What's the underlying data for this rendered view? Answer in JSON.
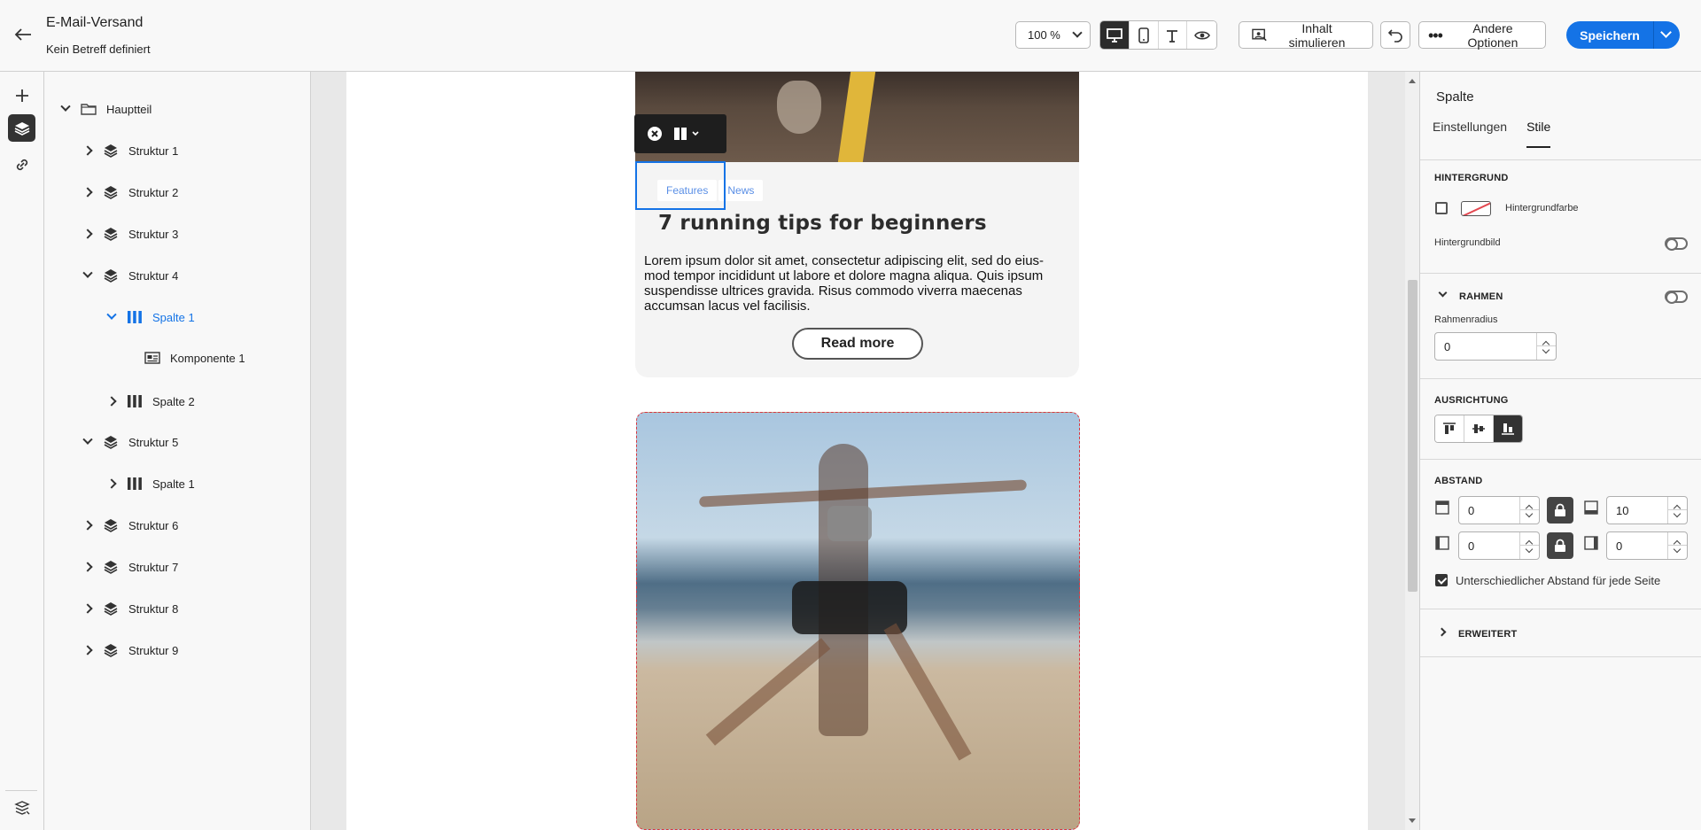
{
  "header": {
    "title": "E-Mail-Versand",
    "subtitle": "Kein Betreff definiert",
    "zoom": "100 %",
    "simulate_label": "Inhalt simulieren",
    "other_options_label": "Andere Optionen",
    "save_label": "Speichern"
  },
  "tree": {
    "root": "Hauptteil",
    "nodes": {
      "s1": "Struktur 1",
      "s2": "Struktur 2",
      "s3": "Struktur 3",
      "s4": "Struktur 4",
      "s4c1": "Spalte 1",
      "s4c1k": "Komponente 1",
      "s4c2": "Spalte 2",
      "s5": "Struktur 5",
      "s5c1": "Spalte 1",
      "s6": "Struktur 6",
      "s7": "Struktur 7",
      "s8": "Struktur 8",
      "s9": "Struktur 9"
    }
  },
  "canvas": {
    "tags": [
      "Features",
      "News"
    ],
    "card_title": "7 running tips for beginners",
    "card_text": "Lorem ipsum dolor sit amet, consectetur adipiscing elit, sed do eius-mod tempor incididunt ut labore et dolore magna aliqua. Quis ipsum suspendisse ultrices gravida. Risus commodo viverra maecenas accumsan lacus vel facilisis.",
    "read_more": "Read more"
  },
  "panel": {
    "title": "Spalte",
    "tabs": [
      "Einstellungen",
      "Stile"
    ],
    "active_tab": "Stile",
    "background_section": "HINTERGRUND",
    "background_color_label": "Hintergrundfarbe",
    "background_image_label": "Hintergrundbild",
    "border_section": "RAHMEN",
    "border_radius_label": "Rahmenradius",
    "border_radius_value": "0",
    "alignment_section": "AUSRICHTUNG",
    "spacing_section": "ABSTAND",
    "padding_top": "0",
    "padding_bottom": "10",
    "padding_left": "0",
    "padding_right": "0",
    "different_spacing_label": "Unterschiedlicher Abstand für jede Seite",
    "advanced_section": "ERWEITERT"
  },
  "colors": {
    "accent": "#1473e6",
    "selection": "#1473e6",
    "dashed_border": "#d9363e"
  }
}
